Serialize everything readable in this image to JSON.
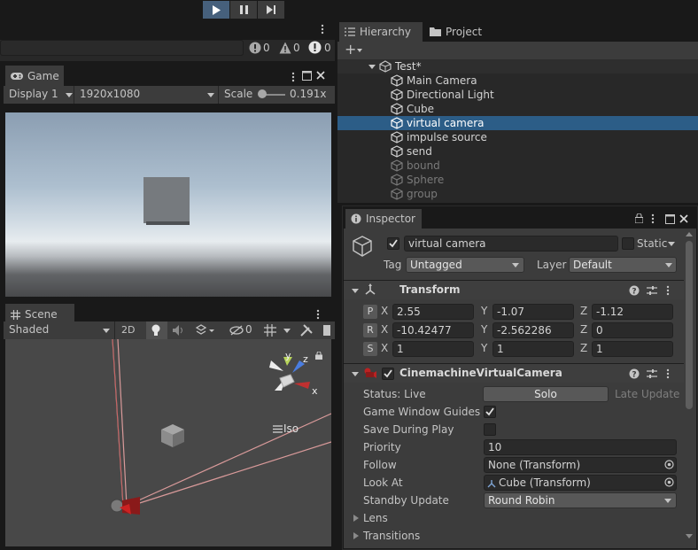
{
  "console": {
    "error_count": "0",
    "warning_count": "0",
    "info_count": "0"
  },
  "game": {
    "tab_label": "Game",
    "display": "Display 1",
    "resolution": "1920x1080",
    "scale_label": "Scale",
    "scale_value": "0.191x"
  },
  "scene": {
    "tab_label": "Scene",
    "shading": "Shaded",
    "mode_2d": "2D",
    "hidden_count": "0",
    "projection_label": "Iso",
    "gizmo_axes": {
      "x": "x",
      "y": "y",
      "z": "z"
    }
  },
  "hierarchy": {
    "tab_label": "Hierarchy",
    "project_tab": "Project",
    "scene_name": "Test*",
    "items": [
      {
        "label": "Main Camera",
        "active": true,
        "selected": false
      },
      {
        "label": "Directional Light",
        "active": true,
        "selected": false
      },
      {
        "label": "Cube",
        "active": true,
        "selected": false
      },
      {
        "label": "virtual camera",
        "active": true,
        "selected": true
      },
      {
        "label": "impulse source",
        "active": true,
        "selected": false
      },
      {
        "label": "send",
        "active": true,
        "selected": false
      },
      {
        "label": "bound",
        "active": false,
        "selected": false
      },
      {
        "label": "Sphere",
        "active": false,
        "selected": false
      },
      {
        "label": "group",
        "active": false,
        "selected": false
      }
    ]
  },
  "inspector": {
    "tab_label": "Inspector",
    "object_name": "virtual camera",
    "static_label": "Static",
    "tag_label": "Tag",
    "tag_value": "Untagged",
    "layer_label": "Layer",
    "layer_value": "Default",
    "transform": {
      "title": "Transform",
      "position": {
        "btn": "P",
        "x": "2.55",
        "y": "-1.07",
        "z": "-1.12"
      },
      "rotation": {
        "btn": "R",
        "x": "-10.42477",
        "y": "-2.562286",
        "z": "0"
      },
      "scale": {
        "btn": "S",
        "x": "1",
        "y": "1",
        "z": "1"
      },
      "axis_labels": {
        "x": "X",
        "y": "Y",
        "z": "Z"
      }
    },
    "cinemachine": {
      "title": "CinemachineVirtualCamera",
      "status_label": "Status: Live",
      "solo_button": "Solo",
      "late_update": "Late Update",
      "game_window_guides_label": "Game Window Guides",
      "save_during_play_label": "Save During Play",
      "priority_label": "Priority",
      "priority_value": "10",
      "follow_label": "Follow",
      "follow_value": "None (Transform)",
      "look_at_label": "Look At",
      "look_at_value": "Cube (Transform)",
      "standby_label": "Standby Update",
      "standby_value": "Round Robin",
      "lens_label": "Lens",
      "transitions_label": "Transitions"
    }
  },
  "colors": {
    "accent": "#46607c",
    "selection": "#2c5d87",
    "panel": "#3c3c3c",
    "dark": "#282828"
  }
}
